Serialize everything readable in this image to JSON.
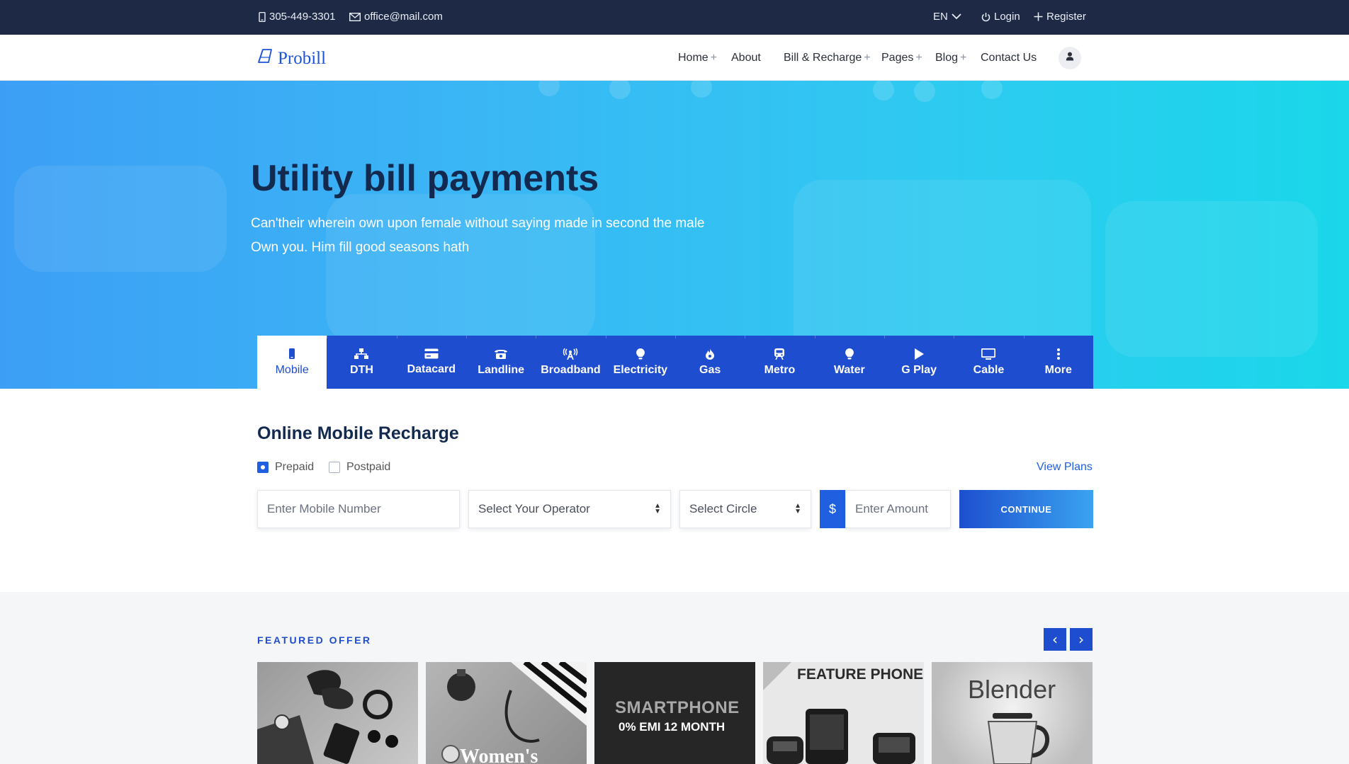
{
  "topbar": {
    "phone": "305-449-3301",
    "email": "office@mail.com",
    "language": "EN",
    "login": "Login",
    "register": "Register"
  },
  "brand": {
    "name": "Probill",
    "color": "#1b54d8"
  },
  "nav": {
    "items": [
      {
        "label": "Home",
        "has_submenu": true
      },
      {
        "label": "About",
        "has_submenu": false
      },
      {
        "label": "Bill & Recharge",
        "has_submenu": true
      },
      {
        "label": "Pages",
        "has_submenu": true
      },
      {
        "label": "Blog",
        "has_submenu": true
      },
      {
        "label": "Contact Us",
        "has_submenu": false
      }
    ],
    "submenu_marker": "+",
    "account_icon": "user-icon"
  },
  "hero": {
    "title": "Utility bill payments",
    "subtitle_line1": "Can'their wherein own upon female without saying made in second the male",
    "subtitle_line2": "Own you. Him fill good seasons hath"
  },
  "services": {
    "active": "Mobile",
    "tabs": [
      {
        "label": "Mobile",
        "icon": "mobile-icon"
      },
      {
        "label": "DTH",
        "icon": "network-icon"
      },
      {
        "label": "Datacard",
        "icon": "credit-card-icon"
      },
      {
        "label": "Landline",
        "icon": "phone-icon"
      },
      {
        "label": "Broadband",
        "icon": "broadcast-tower-icon"
      },
      {
        "label": "Electricity",
        "icon": "lightbulb-icon"
      },
      {
        "label": "Gas",
        "icon": "flame-icon"
      },
      {
        "label": "Metro",
        "icon": "train-icon"
      },
      {
        "label": "Water",
        "icon": "lightbulb-icon"
      },
      {
        "label": "G Play",
        "icon": "play-icon"
      },
      {
        "label": "Cable",
        "icon": "tv-icon"
      },
      {
        "label": "More",
        "icon": "more-vertical-icon"
      }
    ]
  },
  "recharge": {
    "title": "Online Mobile Recharge",
    "plan_types": [
      {
        "label": "Prepaid",
        "checked": true
      },
      {
        "label": "Postpaid",
        "checked": false
      }
    ],
    "view_plans": "View Plans",
    "mobile_placeholder": "Enter Mobile Number",
    "operator_selected": "Select Your Operator",
    "circle_selected": "Select Circle",
    "currency_symbol": "$",
    "amount_placeholder": "Enter Amount",
    "continue_label": "CONTINUE"
  },
  "featured": {
    "label": "FEATURED OFFER",
    "prev": "‹",
    "next": "›",
    "cards": [
      {
        "name": "accessories",
        "caption": ""
      },
      {
        "name": "womens",
        "caption": "Women's"
      },
      {
        "name": "smartphone",
        "caption": "SMARTPHONE",
        "caption2": "0% EMI 12 MONTH"
      },
      {
        "name": "feature-phone",
        "caption": "FEATURE PHONE"
      },
      {
        "name": "blender",
        "caption": "Blender"
      }
    ]
  },
  "colors": {
    "topbar_bg": "#1e2a45",
    "primary": "#1f4dd0",
    "title_dark": "#13294e",
    "hero_gradient_start": "#3c9ff5",
    "hero_gradient_end": "#1ad7ea"
  }
}
